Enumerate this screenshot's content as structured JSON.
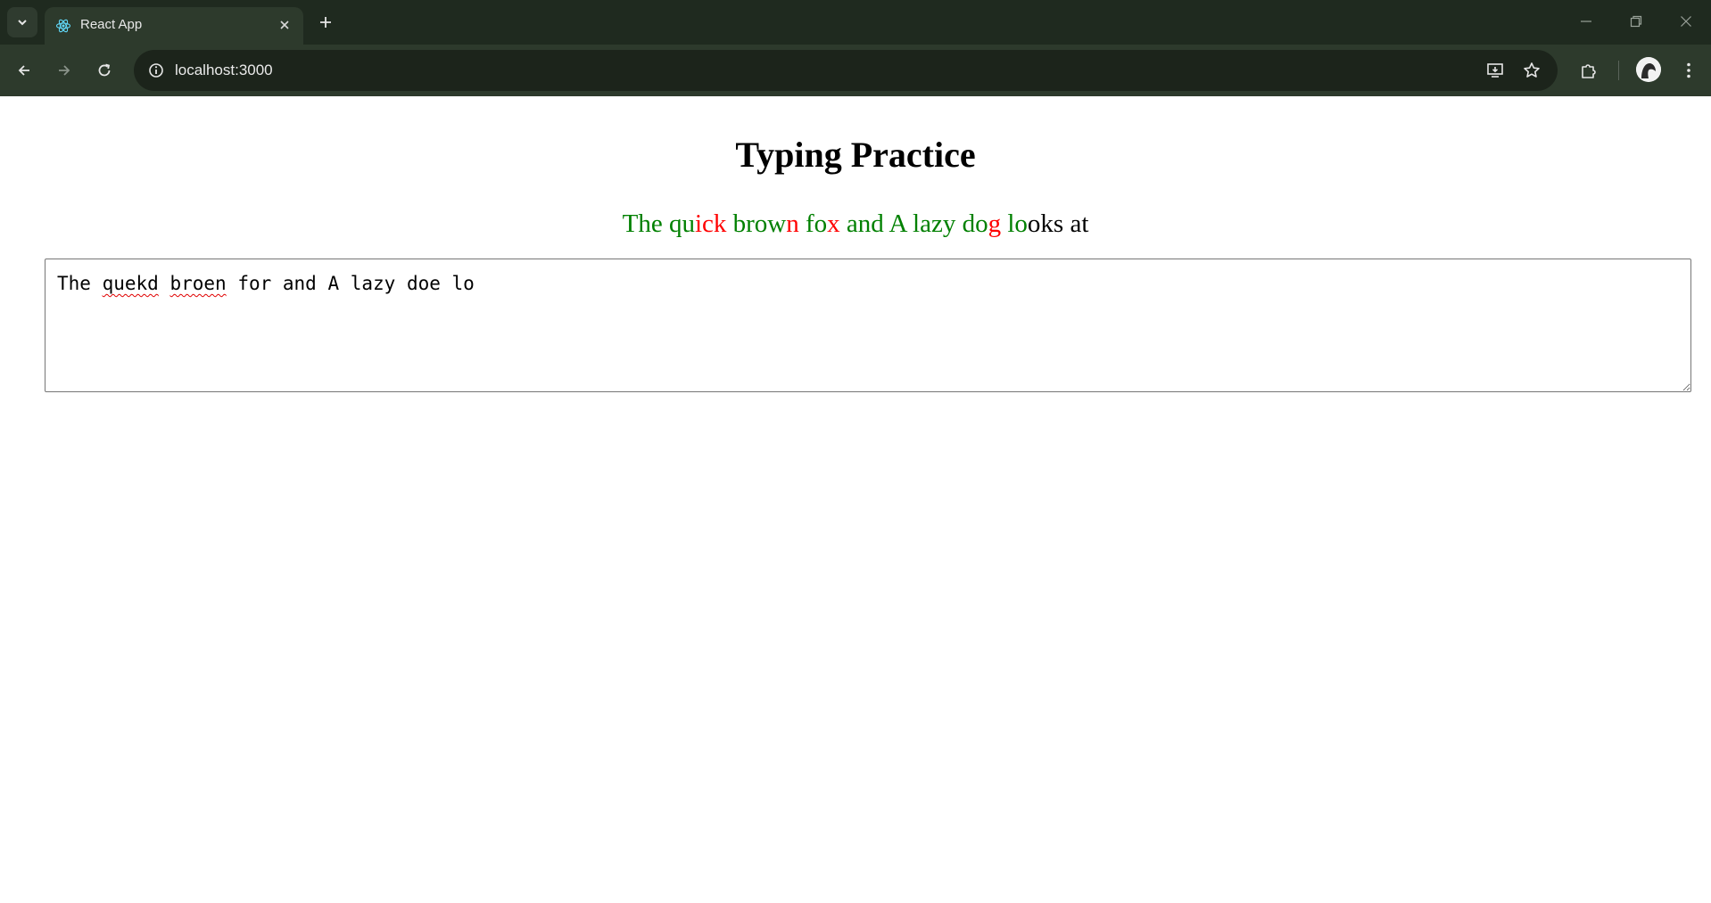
{
  "browser": {
    "tab_title": "React App",
    "url": "localhost:3000",
    "icons": {
      "tab_search": "chevron-down-icon",
      "favicon": "react-logo-icon",
      "tab_close": "close-icon",
      "new_tab": "plus-icon",
      "back": "arrow-left-icon",
      "forward": "arrow-right-icon",
      "reload": "reload-icon",
      "site_info": "info-icon",
      "install_app": "install-icon",
      "bookmark": "star-icon",
      "extensions": "puzzle-icon",
      "profile": "avatar",
      "menu": "kebab-menu-icon"
    }
  },
  "page": {
    "title": "Typing Practice",
    "target_segments": [
      {
        "text": "The qu",
        "status": "correct",
        "color": "#008000"
      },
      {
        "text": "ick",
        "status": "incorrect",
        "color": "#ff0000"
      },
      {
        "text": " brow",
        "status": "correct",
        "color": "#008000"
      },
      {
        "text": "n",
        "status": "incorrect",
        "color": "#ff0000"
      },
      {
        "text": " fo",
        "status": "correct",
        "color": "#008000"
      },
      {
        "text": "x",
        "status": "incorrect",
        "color": "#ff0000"
      },
      {
        "text": " and A lazy do",
        "status": "correct",
        "color": "#008000"
      },
      {
        "text": "g",
        "status": "incorrect",
        "color": "#ff0000"
      },
      {
        "text": " lo",
        "status": "correct",
        "color": "#008000"
      },
      {
        "text": "oks at",
        "status": "pending",
        "color": "#000000"
      }
    ],
    "input": {
      "value": "The quekd broen for and A lazy doe lo",
      "parts": [
        {
          "text": "The ",
          "misspelled": false
        },
        {
          "text": "quekd",
          "misspelled": true
        },
        {
          "text": " ",
          "misspelled": false
        },
        {
          "text": "broen",
          "misspelled": true
        },
        {
          "text": " for and A lazy doe lo",
          "misspelled": false
        }
      ]
    }
  }
}
